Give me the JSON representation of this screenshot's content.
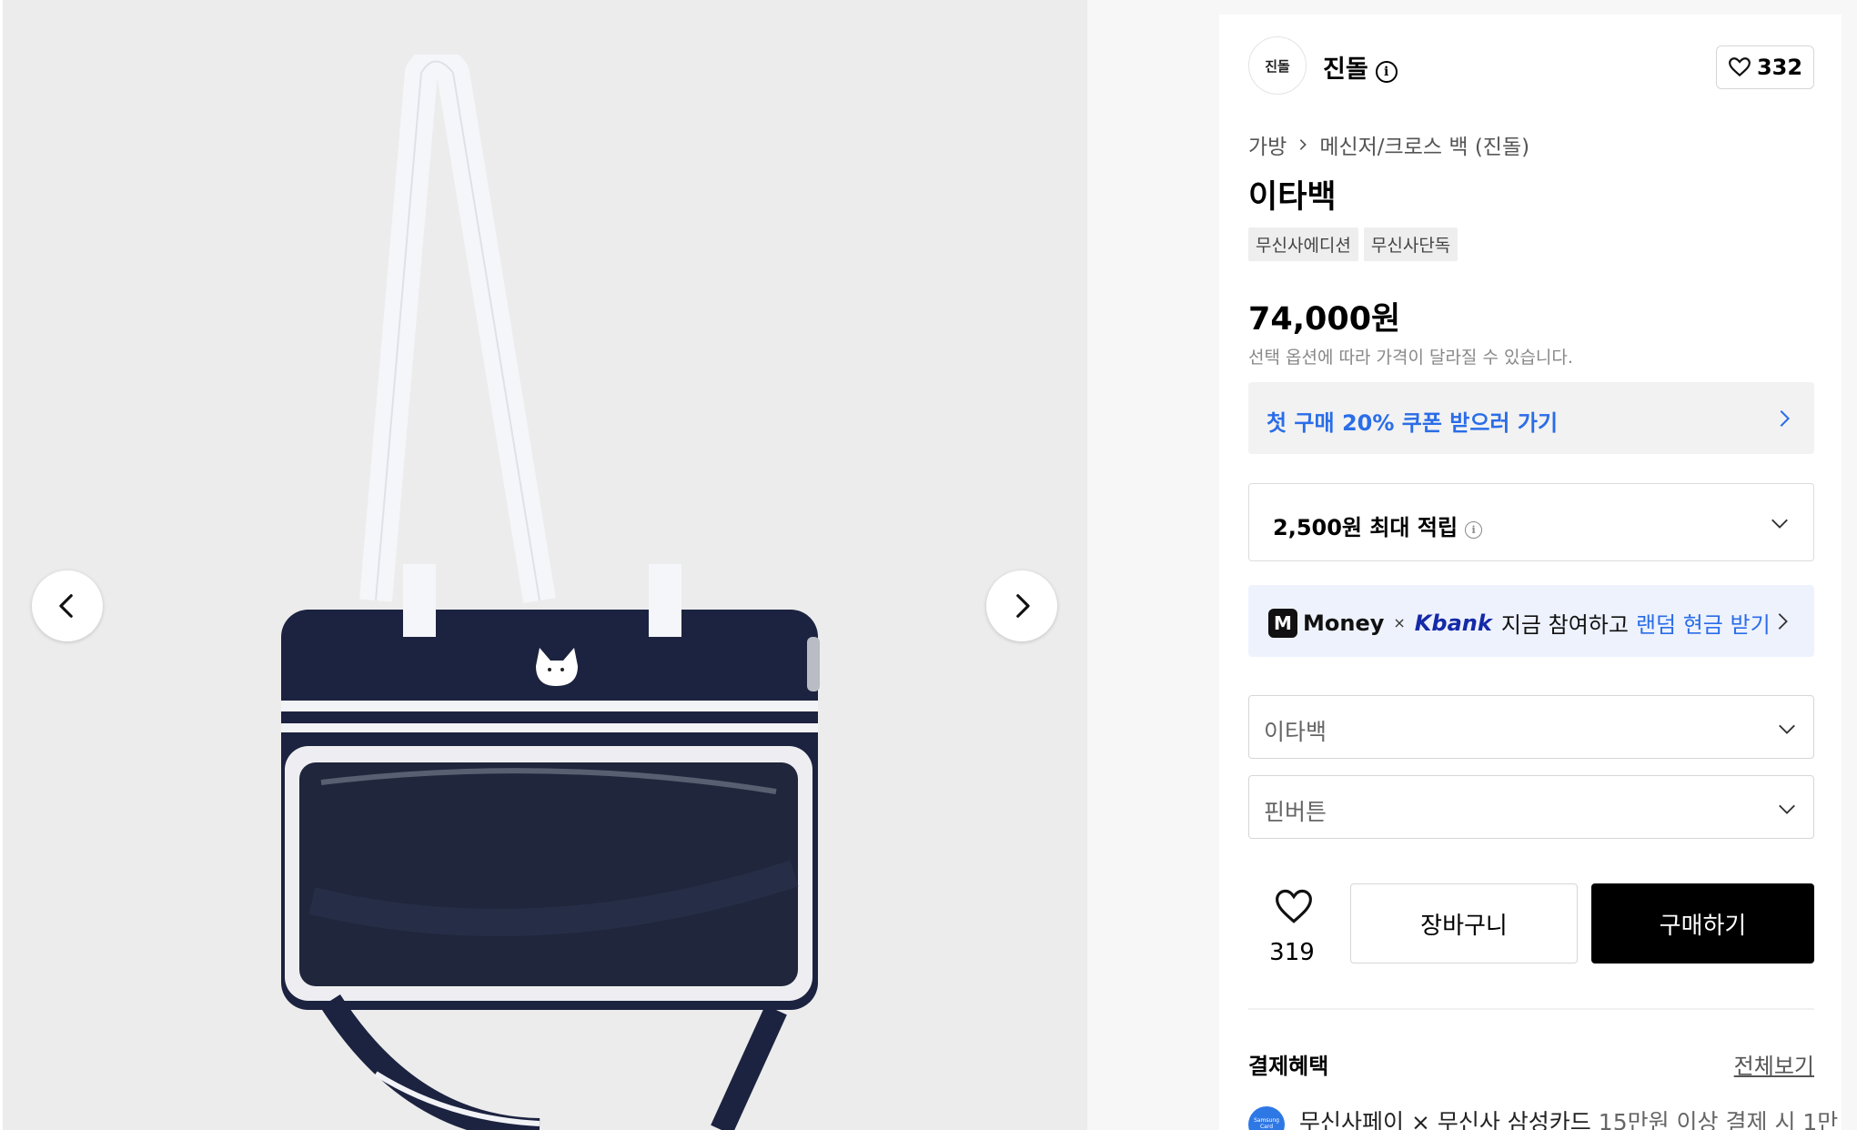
{
  "gallery": {
    "prev_icon": "chevron-left-icon",
    "next_icon": "chevron-right-icon"
  },
  "brand": {
    "logo_text": "진돌",
    "name": "진돌",
    "info_icon": "i",
    "like_count": "332"
  },
  "breadcrumb": {
    "category": "가방",
    "subcategory": "메신저/크로스 백 (진돌)"
  },
  "product": {
    "title": "이타백",
    "tags": [
      "무신사에디션",
      "무신사단독"
    ],
    "price": "74,000원",
    "price_note": "선택 옵션에 따라 가격이 달라질 수 있습니다."
  },
  "coupon": {
    "text": "첫 구매 20% 쿠폰 받으러 가기"
  },
  "points": {
    "text": "2,500원 최대 적립",
    "info_icon": "i"
  },
  "promo": {
    "badge": "M",
    "money": "Money",
    "times": "×",
    "kbank": "Kbank",
    "text": "지금 참여하고",
    "highlight": "랜덤 현금 받기"
  },
  "options": {
    "option1": "이타백",
    "option2": "핀버튼"
  },
  "actions": {
    "wish_count": "319",
    "cart_label": "장바구니",
    "buy_label": "구매하기"
  },
  "benefits": {
    "title": "결제혜택",
    "view_all": "전체보기",
    "card_icon_text": "Samsung Card",
    "line_strong": "무신사페이 × 무신사 삼성카드",
    "line_desc": "15만원 이상 결제 시 1만"
  },
  "colors": {
    "accent_blue": "#2a6de8",
    "kbank_navy": "#152aa8",
    "buy_button": "#000000",
    "promo_bg": "#eef2fd"
  }
}
